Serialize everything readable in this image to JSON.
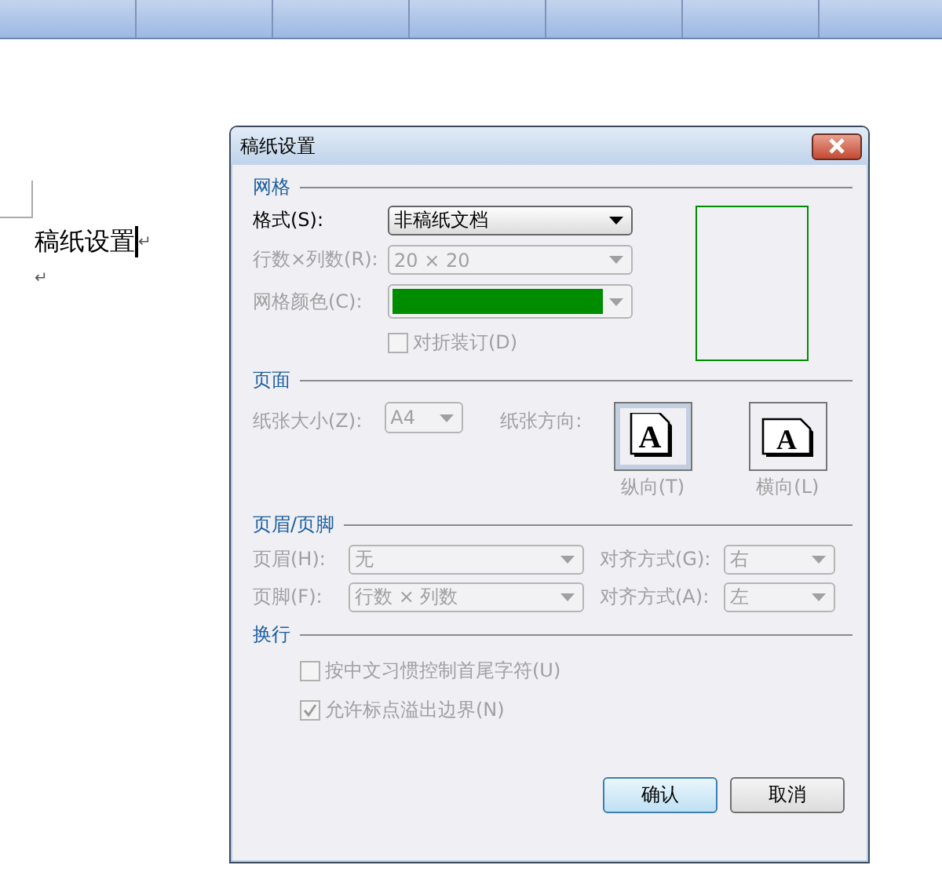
{
  "document": {
    "heading": "稿纸设置",
    "marks": [
      "↵",
      "↵"
    ]
  },
  "dialog": {
    "title": "稿纸设置",
    "grid": {
      "title": "网格",
      "format": {
        "label": "格式(S):",
        "value": "非稿纸文档",
        "disabled": false
      },
      "rows_cols": {
        "label": "行数×列数(R):",
        "value": "20 × 20",
        "disabled": true
      },
      "grid_color": {
        "label": "网格颜色(C):",
        "color": "#008c00",
        "disabled": true
      },
      "fold": {
        "label": "对折装订(D)",
        "checked": false,
        "disabled": true
      }
    },
    "page": {
      "title": "页面",
      "size": {
        "label": "纸张大小(Z):",
        "value": "A4",
        "disabled": true
      },
      "orientation_label": "纸张方向:",
      "orientations": [
        {
          "label": "纵向(T)",
          "glyph": "A",
          "kind": "portrait",
          "selected": true,
          "disabled": true
        },
        {
          "label": "横向(L)",
          "glyph": "A",
          "kind": "landscape",
          "selected": false,
          "disabled": true
        }
      ]
    },
    "header_footer": {
      "title": "页眉/页脚",
      "rows": [
        {
          "label": "页眉(H):",
          "value": "无",
          "align_label": "对齐方式(G):",
          "align_value": "右",
          "disabled": true
        },
        {
          "label": "页脚(F):",
          "value": "行数 × 列数",
          "align_label": "对齐方式(A):",
          "align_value": "左",
          "disabled": true
        }
      ]
    },
    "wrap": {
      "title": "换行",
      "options": [
        {
          "label": "按中文习惯控制首尾字符(U)",
          "checked": false,
          "disabled": true
        },
        {
          "label": "允许标点溢出边界(N)",
          "checked": true,
          "disabled": true
        }
      ]
    },
    "buttons": [
      {
        "label": "确认",
        "default": true
      },
      {
        "label": "取消",
        "default": false
      }
    ]
  }
}
